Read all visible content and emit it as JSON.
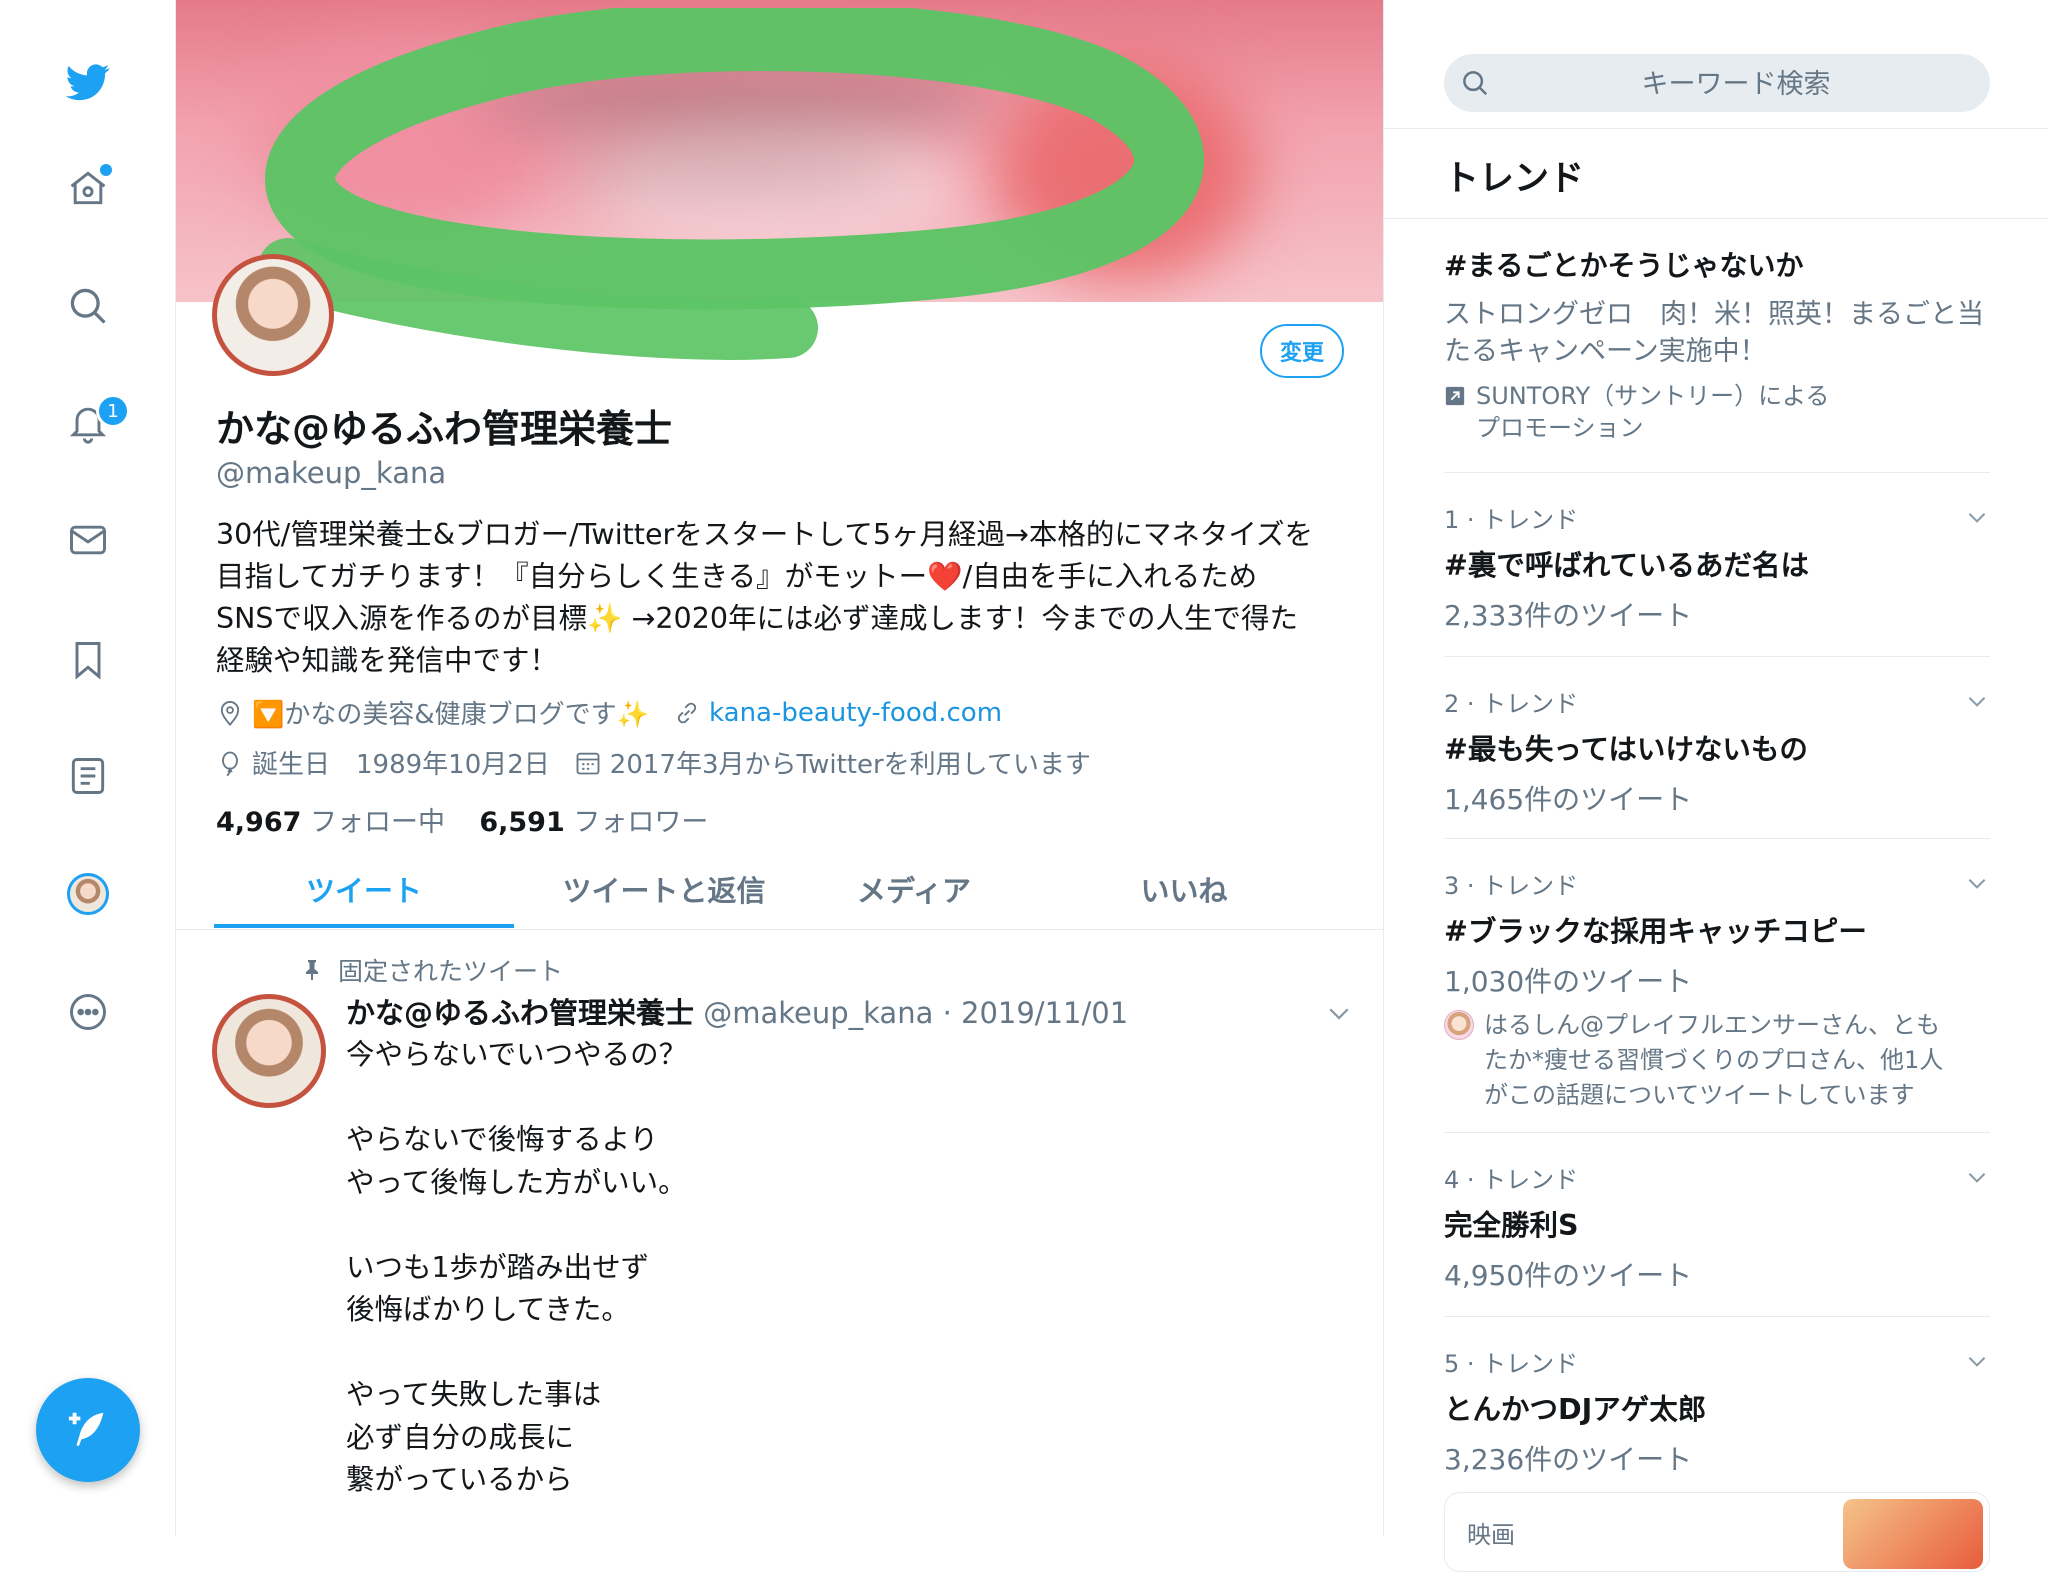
{
  "nav": {
    "items": [
      {
        "name": "twitter-logo-icon"
      },
      {
        "name": "home-icon"
      },
      {
        "name": "explore-search-icon"
      },
      {
        "name": "notifications-bell-icon"
      },
      {
        "name": "messages-envelope-icon"
      },
      {
        "name": "bookmarks-icon"
      },
      {
        "name": "lists-icon"
      },
      {
        "name": "profile-avatar"
      },
      {
        "name": "more-icon"
      }
    ],
    "notification_count": "1",
    "compose_icon": "compose-feather-icon",
    "accent": "#1da1f2"
  },
  "profile": {
    "edit_label": "変更",
    "display_name": "かな@ゆるふわ管理栄養士",
    "handle": "@makeup_kana",
    "bio": "30代/管理栄養士&ブロガー/Twitterをスタートして5ヶ月経過→本格的にマネタイズを\n目指してガチります！『自分らしく生きる』がモットー❤️/自由を手に入れるため\nSNSで収入源を作るのが目標✨ →2020年には必ず達成します！今までの人生で得た\n経験や知識を発信中です！",
    "location": "🔽かなの美容&健康ブログです✨",
    "website": "kana-beauty-food.com",
    "birthday": "誕生日　1989年10月2日",
    "joined": "2017年3月からTwitterを利用しています",
    "following_count": "4,967",
    "following_label": "フォロー中",
    "followers_count": "6,591",
    "followers_label": "フォロワー"
  },
  "tabs": [
    {
      "label": "ツイート",
      "active": true
    },
    {
      "label": "ツイートと返信",
      "active": false
    },
    {
      "label": "メディア",
      "active": false
    },
    {
      "label": "いいね",
      "active": false
    }
  ],
  "pinned_tweet": {
    "label": "固定されたツイート",
    "author_name": "かな@ゆるふわ管理栄養士",
    "author_handle_date": "@makeup_kana · 2019/11/01",
    "body": "今やらないでいつやるの？\n\nやらないで後悔するより\nやって後悔した方がいい。\n\nいつも1歩が踏み出せず\n後悔ばかりしてきた。\n\nやって失敗した事は\n必ず自分の成長に\n繋がっているから"
  },
  "search": {
    "placeholder": "キーワード検索"
  },
  "trends": {
    "title": "トレンド",
    "promoted": {
      "tag": "#まるごとかそうじゃないか",
      "desc": "ストロングゼロ　肉！米！照英！まるごと当たるキャンペーン実施中！",
      "by": "SUNTORY（サントリー）による\nプロモーション"
    },
    "items": [
      {
        "rank": "1 · トレンド",
        "name": "#裏で呼ばれているあだ名は",
        "count": "2,333件のツイート"
      },
      {
        "rank": "2 · トレンド",
        "name": "#最も失ってはいけないもの",
        "count": "1,465件のツイート"
      },
      {
        "rank": "3 · トレンド",
        "name": "#ブラックな採用キャッチコピー",
        "count": "1,030件のツイート",
        "context": "はるしん@プレイフルエンサーさん、とも\nたか*痩せる習慣づくりのプロさん、他1人\nがこの話題についてツイートしています"
      },
      {
        "rank": "4 · トレンド",
        "name": "完全勝利S",
        "count": "4,950件のツイート"
      },
      {
        "rank": "5 · トレンド",
        "name": "とんかつDJアゲ太郎",
        "count": "3,236件のツイート"
      }
    ],
    "card_label": "映画"
  }
}
